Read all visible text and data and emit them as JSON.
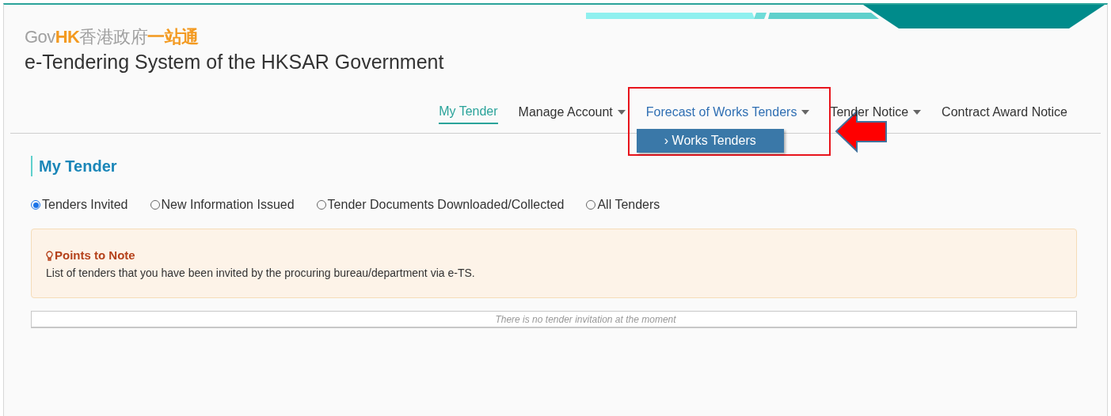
{
  "logo": [
    "Gov",
    "HK",
    "香港政府",
    "一站通"
  ],
  "system_title": "e-Tendering System of the HKSAR Government",
  "nav": [
    {
      "label": "My Tender",
      "selected": true,
      "dropdown": false,
      "open": false
    },
    {
      "label": "Manage Account",
      "selected": false,
      "dropdown": true,
      "open": false
    },
    {
      "label": "Forecast of Works Tenders",
      "selected": false,
      "dropdown": true,
      "open": true,
      "menu": [
        "› Works Tenders"
      ]
    },
    {
      "label": "Tender Notice",
      "selected": false,
      "dropdown": true,
      "open": false
    },
    {
      "label": "Contract Award Notice",
      "selected": false,
      "dropdown": false,
      "open": false
    }
  ],
  "page_title": "My Tender",
  "filters": [
    {
      "label": "Tenders Invited",
      "selected": true
    },
    {
      "label": "New Information Issued",
      "selected": false
    },
    {
      "label": "Tender Documents Downloaded/Collected",
      "selected": false
    },
    {
      "label": "All Tenders",
      "selected": false
    }
  ],
  "note": {
    "title": "Points to Note",
    "text": "List of tenders that you have been invited by the procuring bureau/department via e-TS."
  },
  "empty_message": "There is no tender invitation at the moment"
}
